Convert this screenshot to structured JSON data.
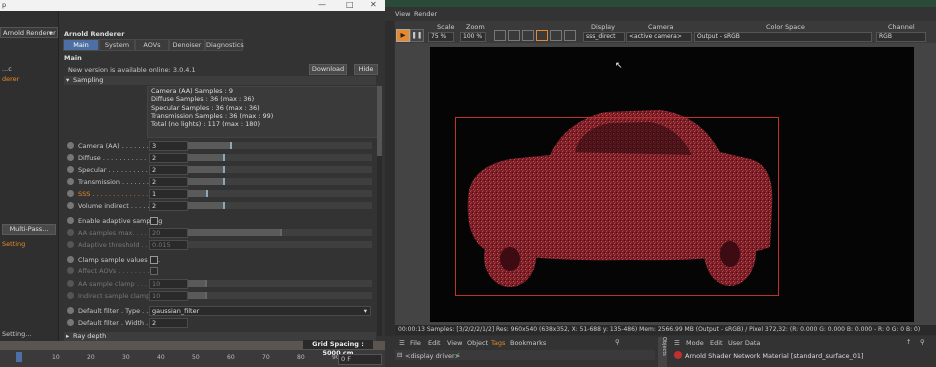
{
  "left_window": {
    "title": "p",
    "renderer_select": "Arnold Renderer",
    "side_labels": [
      "...c",
      "derer"
    ],
    "multipass_button": "Multi-Pass...",
    "side_setting": "Setting",
    "side_setting2": "Setting..."
  },
  "panel": {
    "title": "Arnold Renderer",
    "tabs": [
      "Main",
      "System",
      "AOVs",
      "Denoiser",
      "Diagnostics"
    ],
    "active_tab": "Main",
    "section_main": "Main",
    "update_msg": "New version is available online: 3.0.4.1",
    "download_label": "Download",
    "hide_label": "Hide",
    "sampling_section": "Sampling",
    "sample_info": [
      "Camera (AA) Samples : 9",
      "Diffuse Samples : 36 (max : 36)",
      "Specular Samples : 36 (max : 36)",
      "Transmission Samples : 36 (max : 99)",
      "Total (no lights) : 117 (max : 180)"
    ],
    "rows": [
      {
        "label": "Camera (AA) . . . . . . . . .",
        "value": "3",
        "fill": 0.23
      },
      {
        "label": "Diffuse . . . . . . . . . . . .",
        "value": "2",
        "fill": 0.19
      },
      {
        "label": "Specular . . . . . . . . . . .",
        "value": "2",
        "fill": 0.19
      },
      {
        "label": "Transmission . . . . . . . .",
        "value": "2",
        "fill": 0.19
      },
      {
        "label": "SSS . . . . . . . . . . . . . .",
        "value": "1",
        "fill": 0.1
      },
      {
        "label": "Volume indirect . . . . . .",
        "value": "2",
        "fill": 0.19
      }
    ],
    "adaptive_label": "Enable adaptive sampling",
    "aa_max_label": "AA samples max. . . . . .",
    "aa_max_value": "20",
    "adaptive_threshold_label": "Adaptive threshold . . . .",
    "adaptive_threshold_value": "0.015",
    "clamp_label": "Clamp sample values . . .",
    "affect_aovs_label": "Affect AOVs . . . . . . . .",
    "aa_clamp_label": "AA sample clamp . . . . .",
    "aa_clamp_value": "10",
    "indirect_clamp_label": "Indirect sample clamp . .",
    "indirect_clamp_value": "10",
    "filter_type_label": "Default filter . Type . . . . .",
    "filter_type_value": "gaussian_filter",
    "filter_width_label": "Default filter . Width . . . .",
    "filter_width_value": "2",
    "ray_depth_label": "Ray depth"
  },
  "timeline": {
    "ticks": [
      "0",
      "10",
      "20",
      "30",
      "40",
      "50",
      "60",
      "70",
      "80",
      "90"
    ],
    "grid_spacing": "Grid Spacing : 5000 cm",
    "frame": "0 F"
  },
  "viewer": {
    "menu": [
      "View",
      "Render"
    ],
    "scale_label": "Scale",
    "scale_value": "75 %",
    "zoom_label": "Zoom",
    "zoom_value": "100 %",
    "display_label": "Display",
    "display_value": "sss_direct",
    "camera_label": "Camera",
    "camera_value": "<active camera>",
    "colorspace_label": "Color Space",
    "colorspace_value": "Output - sRGB",
    "channel_label": "Channel",
    "channel_value": "RGB",
    "status": "00:00:13 Samples: [3/2/2/2/1/2] Res: 960x540 (638x352, X: 51-688 y: 135-486) Mem: 2566.99 MB (Output - sRGB) / Pixel 372,32: (R: 0.000 G: 0.000 B: 0.000 - R: 0 G: 0 B: 0)",
    "render_accent": "#c03030"
  },
  "bottom": {
    "menu": [
      "File",
      "Edit",
      "View",
      "Object",
      "Tags",
      "Bookmarks"
    ],
    "object_item": "<display driver>",
    "vertical_tab": "Objects",
    "mat_menu": [
      "Mode",
      "Edit",
      "User Data"
    ],
    "material_title": "Arnold Shader Network Material [standard_surface_01]"
  }
}
